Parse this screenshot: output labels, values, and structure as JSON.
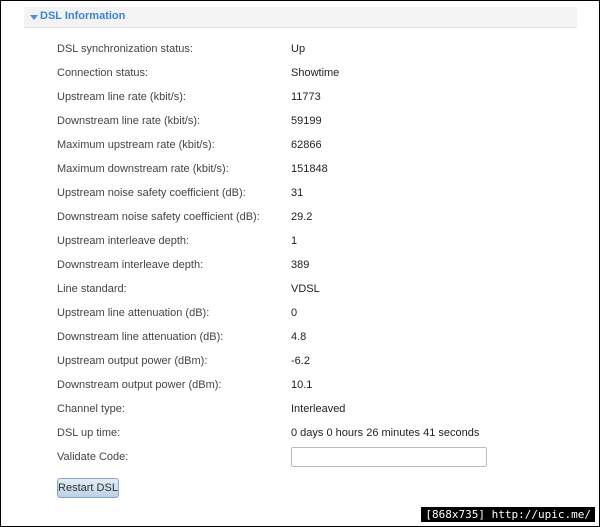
{
  "panel": {
    "title": "DSL Information"
  },
  "rows": [
    {
      "label": "DSL synchronization status:",
      "value": "Up"
    },
    {
      "label": "Connection status:",
      "value": "Showtime"
    },
    {
      "label": "Upstream line rate (kbit/s):",
      "value": "11773"
    },
    {
      "label": "Downstream line rate (kbit/s):",
      "value": "59199"
    },
    {
      "label": "Maximum upstream rate (kbit/s):",
      "value": "62866"
    },
    {
      "label": "Maximum downstream rate (kbit/s):",
      "value": "151848"
    },
    {
      "label": "Upstream noise safety coefficient (dB):",
      "value": "31"
    },
    {
      "label": "Downstream noise safety coefficient (dB):",
      "value": "29.2"
    },
    {
      "label": "Upstream interleave depth:",
      "value": "1"
    },
    {
      "label": "Downstream interleave depth:",
      "value": "389"
    },
    {
      "label": "Line standard:",
      "value": "VDSL"
    },
    {
      "label": "Upstream line attenuation (dB):",
      "value": "0"
    },
    {
      "label": "Downstream line attenuation (dB):",
      "value": "4.8"
    },
    {
      "label": "Upstream output power (dBm):",
      "value": "-6.2"
    },
    {
      "label": "Downstream output power (dBm):",
      "value": "10.1"
    },
    {
      "label": "Channel type:",
      "value": "Interleaved"
    },
    {
      "label": "DSL up time:",
      "value": "0 days 0 hours 26 minutes 41 seconds"
    }
  ],
  "validate": {
    "label": "Validate Code:",
    "value": ""
  },
  "restart_button": {
    "label": "Restart DSL"
  },
  "watermark": {
    "text": "[868x735] http://upic.me/"
  },
  "colors": {
    "header_text": "#3b83d3",
    "header_bg": "#f3f3f3",
    "caret": "#4a8fd9"
  }
}
